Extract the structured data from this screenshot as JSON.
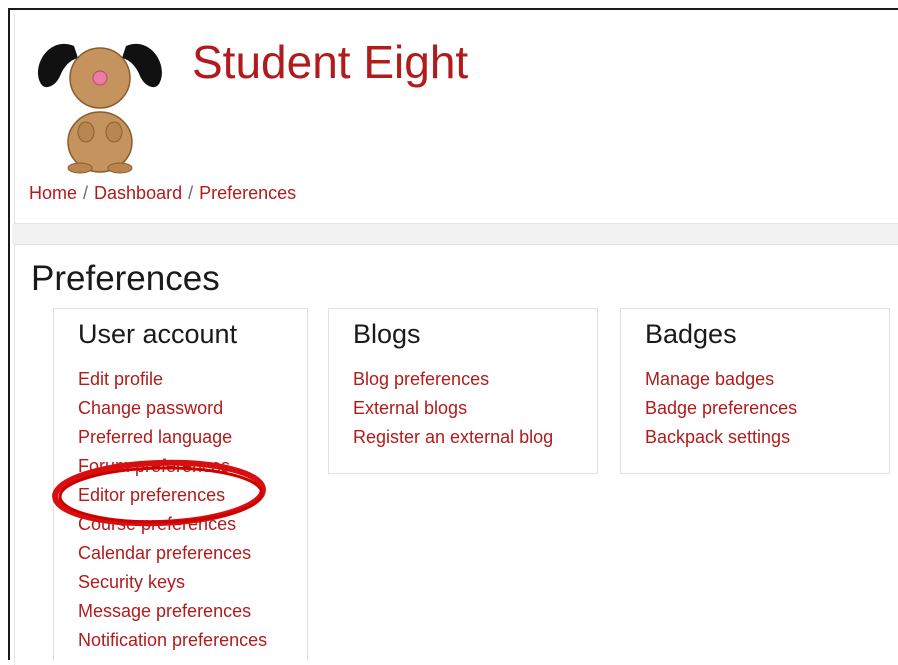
{
  "header": {
    "user_name": "Student Eight",
    "avatar": "cartoon-dog-avatar"
  },
  "breadcrumb": {
    "items": [
      "Home",
      "Dashboard",
      "Preferences"
    ],
    "separator": "/"
  },
  "page": {
    "title": "Preferences"
  },
  "sections": {
    "user_account": {
      "title": "User account",
      "links": [
        "Edit profile",
        "Change password",
        "Preferred language",
        "Forum preferences",
        "Editor preferences",
        "Course preferences",
        "Calendar preferences",
        "Security keys",
        "Message preferences",
        "Notification preferences"
      ]
    },
    "blogs": {
      "title": "Blogs",
      "links": [
        "Blog preferences",
        "External blogs",
        "Register an external blog"
      ]
    },
    "badges": {
      "title": "Badges",
      "links": [
        "Manage badges",
        "Badge preferences",
        "Backpack settings"
      ]
    }
  },
  "annotation": {
    "highlighted_item": "Editor preferences",
    "ring_color": "#d90f0f"
  },
  "colors": {
    "link": "#b11b1b",
    "heading": "#1a1a1a",
    "band": "#f2f2f2"
  }
}
